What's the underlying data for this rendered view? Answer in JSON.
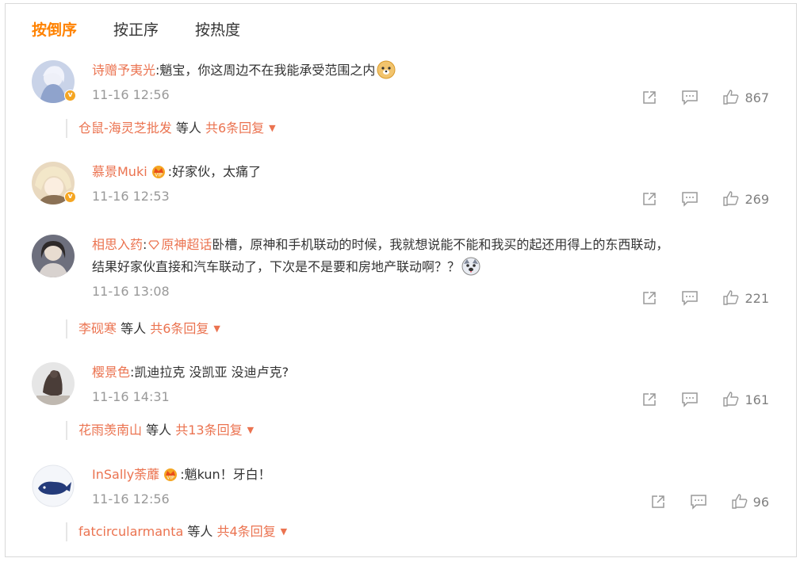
{
  "tabs": [
    {
      "label": "按倒序",
      "active": true
    },
    {
      "label": "按正序",
      "active": false
    },
    {
      "label": "按热度",
      "active": false
    }
  ],
  "comments": [
    {
      "user": "诗赠予夷光",
      "text": ":魈宝，你这周边不在我能承受范围之内",
      "time": "11-16 12:56",
      "likes": "867",
      "reply": {
        "name": "仓鼠-海灵芝批发",
        "suffix": "等人",
        "total": "共6条回复"
      }
    },
    {
      "user": "慕景Muki",
      "text": ":好家伙，太痛了",
      "time": "11-16 12:53",
      "likes": "269"
    },
    {
      "user": "相思入药",
      "super_prefix": ":",
      "super_topic": "原神超话",
      "text_line1": "卧槽，原神和手机联动的时候，我就想说能不能和我买的起还用得上的东西联动，",
      "text_line2": "结果好家伙直接和汽车联动了，下次是不是要和房地产联动啊？？",
      "time": "11-16 13:08",
      "likes": "221",
      "reply": {
        "name": "李砚寒",
        "suffix": "等人",
        "total": "共6条回复"
      }
    },
    {
      "user": "樱景色",
      "text": ":凯迪拉克 没凯亚 没迪卢克?",
      "time": "11-16 14:31",
      "likes": "161",
      "reply": {
        "name": "花雨羡南山",
        "suffix": "等人",
        "total": "共13条回复"
      }
    },
    {
      "user": "InSally荼蘼",
      "text": ":魈kun！牙白！",
      "time": "11-16 12:56",
      "likes": "96",
      "reply": {
        "name": "fatcircularmanta",
        "suffix": "等人",
        "total": "共4条回复"
      }
    }
  ],
  "colors": {
    "accent": "#ff8200",
    "username": "#eb7350",
    "meta": "#999999"
  }
}
